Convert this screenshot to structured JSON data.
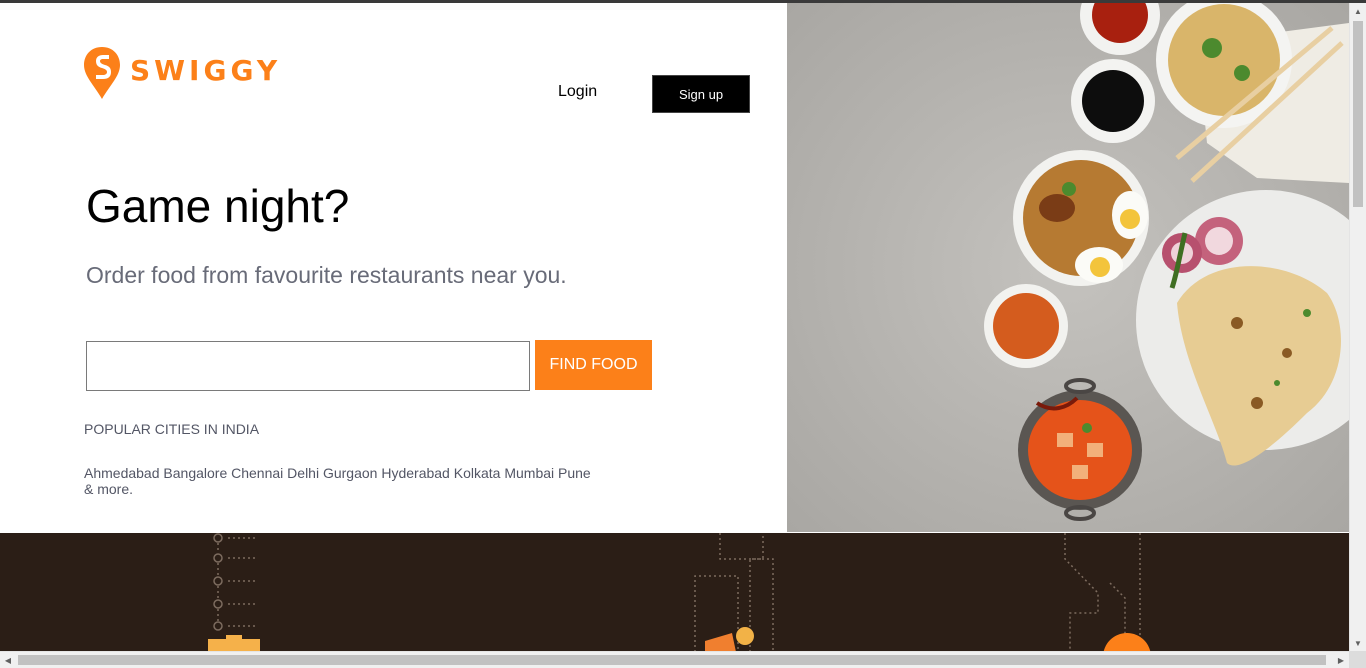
{
  "brand": {
    "name": "SWIGGY",
    "accent_color": "#fc8019",
    "logo_icon": "swiggy-pin-icon"
  },
  "header": {
    "login_label": "Login",
    "signup_label": "Sign up"
  },
  "hero": {
    "headline": "Game night?",
    "subtitle": "Order food from favourite restaurants near you."
  },
  "search": {
    "value": "",
    "placeholder": "",
    "button_label": "FIND FOOD"
  },
  "popular": {
    "title": "POPULAR CITIES IN INDIA",
    "cities": [
      "Ahmedabad",
      "Bangalore",
      "Chennai",
      "Delhi",
      "Gurgaon",
      "Hyderabad",
      "Kolkata",
      "Mumbai",
      "Pune"
    ],
    "more_label": "& more."
  },
  "food_image": {
    "icon": "food-spread-image"
  },
  "colors": {
    "dark_band": "#2b1e16",
    "text_gray": "#686b78"
  }
}
